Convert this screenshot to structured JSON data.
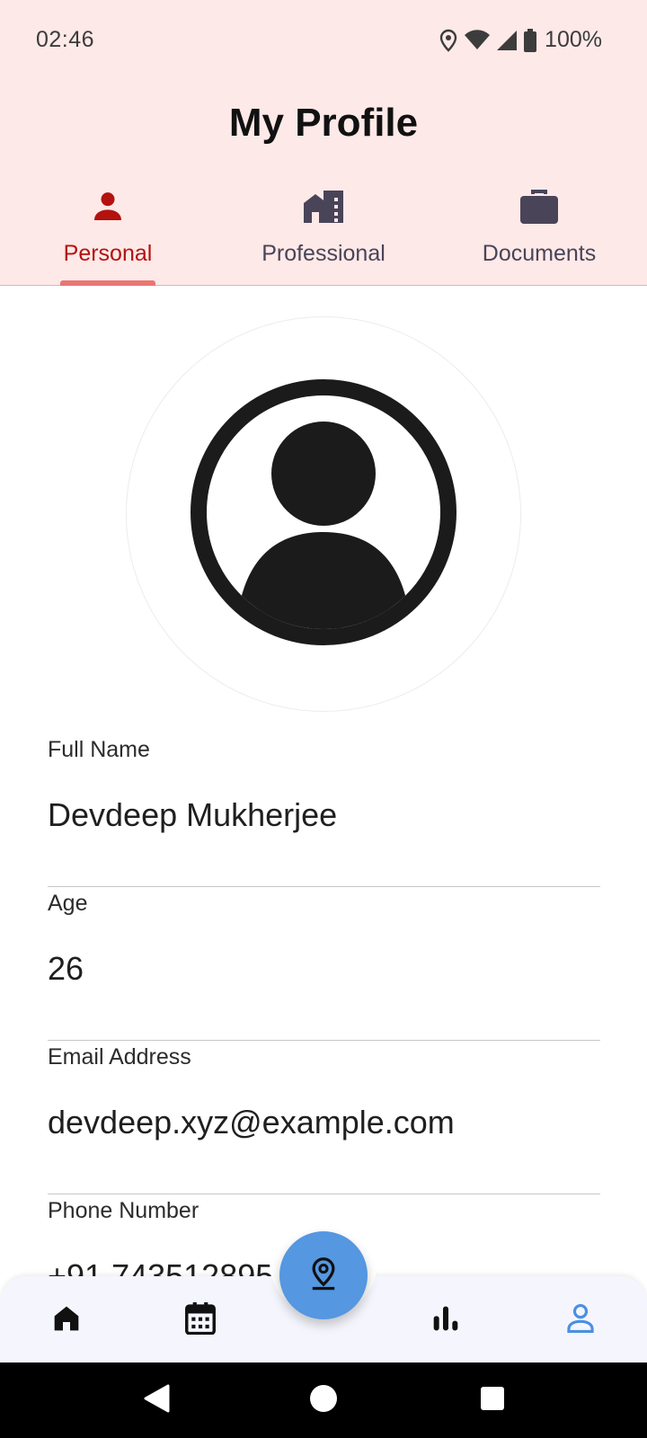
{
  "status_bar": {
    "time": "02:46",
    "battery_percent": "100%",
    "icons": [
      "location-icon",
      "wifi-icon",
      "signal-icon",
      "battery-icon"
    ]
  },
  "header": {
    "title": "My Profile",
    "background_color": "#fde9e8"
  },
  "tabs": [
    {
      "label": "Personal",
      "icon": "person-icon",
      "active": true
    },
    {
      "label": "Professional",
      "icon": "business-icon",
      "active": false
    },
    {
      "label": "Documents",
      "icon": "briefcase-icon",
      "active": false
    }
  ],
  "profile": {
    "avatar_icon": "account-circle-icon",
    "fields": [
      {
        "label": "Full Name",
        "value": "Devdeep Mukherjee"
      },
      {
        "label": "Age",
        "value": "26"
      },
      {
        "label": "Email Address",
        "value": "devdeep.xyz@example.com"
      },
      {
        "label": "Phone Number",
        "value": "+91 7435128956"
      }
    ]
  },
  "bottom_nav": {
    "items": [
      {
        "icon": "home-icon",
        "active": false
      },
      {
        "icon": "calendar-icon",
        "active": false
      },
      {
        "icon": "bar-chart-icon",
        "active": false
      },
      {
        "icon": "profile-icon",
        "active": true
      }
    ],
    "fab_icon": "location-pin-icon",
    "accent_color": "#5597e0"
  },
  "system_nav": [
    "back-icon",
    "home-circle-icon",
    "recents-icon"
  ],
  "colors": {
    "active_tab": "#b3120f",
    "inactive_tab": "#4a4458",
    "indicator": "#e97672"
  }
}
